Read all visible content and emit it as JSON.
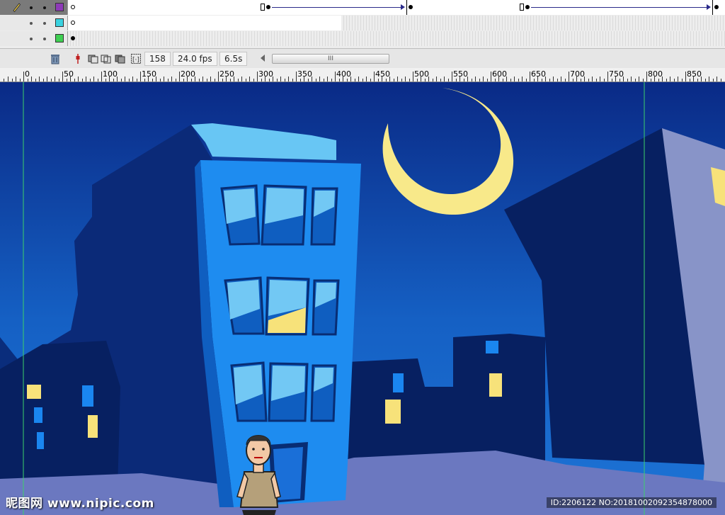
{
  "timeline": {
    "layers": [
      {
        "active": true,
        "color": "#8e3ab8"
      },
      {
        "active": false,
        "color": "#3ad2e0"
      },
      {
        "active": false,
        "color": "#3fcf52"
      }
    ],
    "status": {
      "current_frame": "158",
      "frame_rate": "24.0 fps",
      "elapsed_time": "6.5s",
      "scroll_thumb_glyph": "III"
    }
  },
  "ruler": {
    "labels": [
      "0",
      "50",
      "100",
      "150",
      "200",
      "250",
      "300",
      "350",
      "400",
      "450",
      "500",
      "550",
      "600",
      "650",
      "700",
      "750",
      "800",
      "850"
    ]
  },
  "stage": {
    "colors": {
      "sky_top": "#0a2a86",
      "sky_bottom": "#1d74d6",
      "moon": "#f8e98a",
      "building_bright": "#1e8cf0",
      "building_dark": "#08246a",
      "window_light": "#72c8f4",
      "window_lit": "#f7e27a",
      "ground": "#6b78c0"
    }
  },
  "watermark": {
    "left": "昵图网 www.nipic.com",
    "right": "ID:2206122 NO:20181002092354878000"
  }
}
